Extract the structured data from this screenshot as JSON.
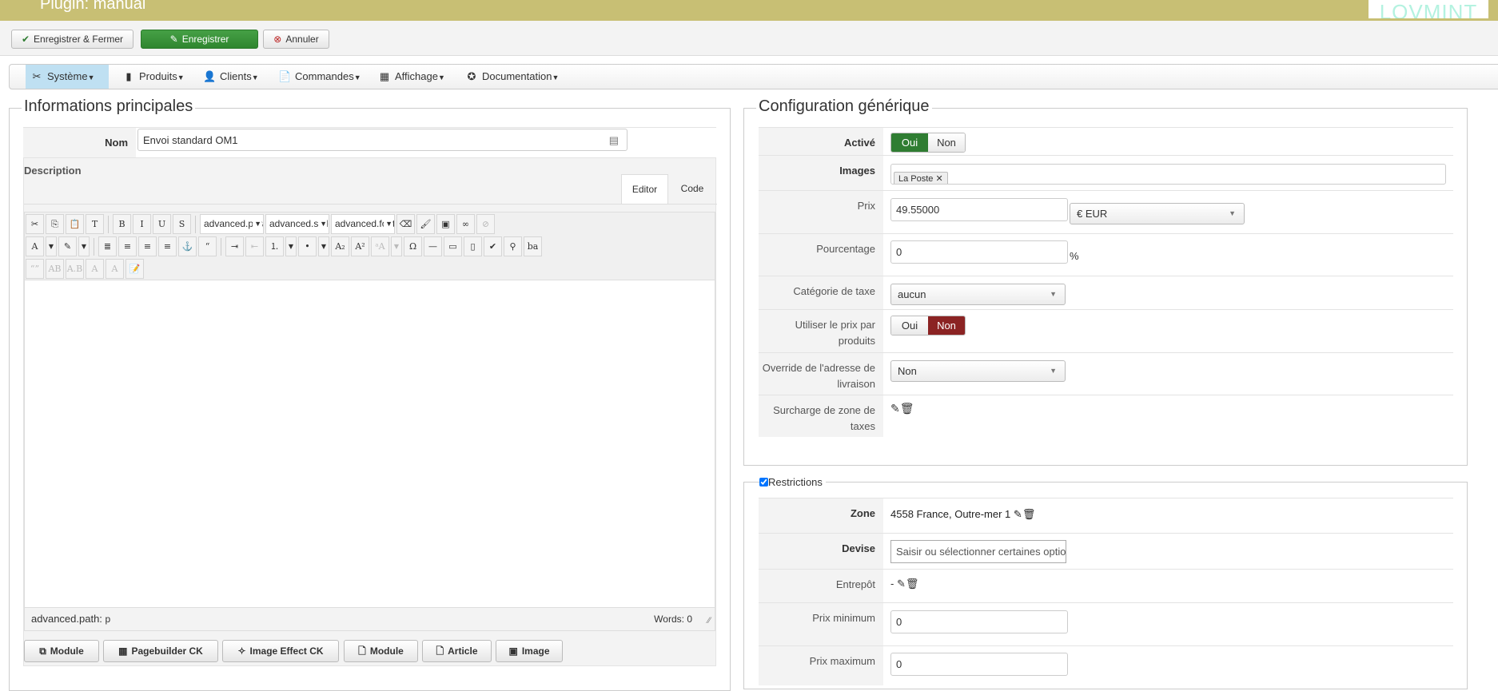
{
  "header": {
    "title": "Plugin: manual",
    "logo": "LOVMINT"
  },
  "toolbar": {
    "save_close": "Enregistrer & Fermer",
    "save": "Enregistrer",
    "cancel": "Annuler"
  },
  "menu": [
    {
      "label": "Système",
      "icon": "wrench-icon",
      "glyph": "✂"
    },
    {
      "label": "Produits",
      "icon": "box-icon",
      "glyph": "▮"
    },
    {
      "label": "Clients",
      "icon": "user-icon",
      "glyph": "👤"
    },
    {
      "label": "Commandes",
      "icon": "order-icon",
      "glyph": "📄"
    },
    {
      "label": "Affichage",
      "icon": "display-icon",
      "glyph": "▦"
    },
    {
      "label": "Documentation",
      "icon": "help-icon",
      "glyph": "✪"
    }
  ],
  "left": {
    "legend": "Informations principales",
    "nom_label": "Nom",
    "nom_value": "Envoi standard OM1",
    "description_label": "Description",
    "tabs": [
      "Editor",
      "Code"
    ],
    "editor_rows": [
      [
        {
          "n": "cut-icon",
          "g": "✂"
        },
        {
          "n": "copy-icon",
          "g": "⎘"
        },
        {
          "n": "paste-icon",
          "g": "📋"
        },
        {
          "n": "paste-text-icon",
          "g": "T"
        },
        {
          "sep": 1
        },
        {
          "n": "bold-icon",
          "g": "B"
        },
        {
          "n": "italic-icon",
          "g": "I"
        },
        {
          "n": "underline-icon",
          "g": "U"
        },
        {
          "n": "strikethrough-icon",
          "g": "S"
        },
        {
          "sep": 1
        },
        {
          "dd": "advanced.paragraph"
        },
        {
          "dd": "advanced.style"
        },
        {
          "dd": "advanced.font"
        },
        {
          "n": "eraser-icon",
          "g": "⌫"
        },
        {
          "n": "cleanup-icon",
          "g": "🖌"
        },
        {
          "n": "image-icon",
          "g": "▣"
        },
        {
          "n": "link-icon",
          "g": "∞"
        },
        {
          "n": "unlink-icon",
          "g": "⊘",
          "d": 1
        }
      ],
      [
        {
          "n": "text-color-icon",
          "g": "A"
        },
        {
          "n": "dropdown-icon",
          "g": "▼"
        },
        {
          "n": "highlight-icon",
          "g": "✎"
        },
        {
          "n": "dropdown-icon",
          "g": "▼"
        },
        {
          "sep": 1
        },
        {
          "n": "justify-icon",
          "g": "≣"
        },
        {
          "n": "align-center-icon",
          "g": "≡"
        },
        {
          "n": "align-left-icon",
          "g": "≡"
        },
        {
          "n": "align-right-icon",
          "g": "≡"
        },
        {
          "n": "anchor-icon",
          "g": "⚓"
        },
        {
          "n": "blockquote-icon",
          "g": "“"
        },
        {
          "sep": 1
        },
        {
          "n": "indent-icon",
          "g": "⇥"
        },
        {
          "n": "outdent-icon",
          "g": "⇤",
          "d": 1
        },
        {
          "n": "ordered-list-icon",
          "g": "⒈"
        },
        {
          "n": "dropdown-icon",
          "g": "▼"
        },
        {
          "n": "unordered-list-icon",
          "g": "•"
        },
        {
          "n": "dropdown-icon",
          "g": "▼"
        },
        {
          "n": "subscript-icon",
          "g": "A₂"
        },
        {
          "n": "superscript-icon",
          "g": "A²"
        },
        {
          "n": "font-size-icon",
          "g": "ᵃA",
          "d": 1
        },
        {
          "n": "dropdown-icon",
          "g": "▼",
          "d": 1
        },
        {
          "n": "special-char-icon",
          "g": "Ω"
        },
        {
          "n": "horizontal-rule-icon",
          "g": "—"
        },
        {
          "n": "table-icon",
          "g": "▭"
        },
        {
          "n": "template-icon",
          "g": "▯"
        },
        {
          "n": "spellcheck-icon",
          "g": "✔"
        },
        {
          "n": "search-icon",
          "g": "⚲"
        },
        {
          "n": "replace-icon",
          "g": "ba"
        }
      ],
      [
        {
          "n": "cite-icon",
          "g": "“”",
          "d": 1
        },
        {
          "n": "abbr-icon",
          "g": "AB",
          "d": 1
        },
        {
          "n": "acronym-icon",
          "g": "A.B",
          "d": 1
        },
        {
          "n": "del-icon",
          "g": "A",
          "d": 1
        },
        {
          "n": "ins-icon",
          "g": "A",
          "d": 1
        },
        {
          "n": "attributes-icon",
          "g": "📝"
        }
      ]
    ],
    "path_label": "advanced.path:",
    "path_value": "p",
    "words_label": "Words:",
    "words_value": "0",
    "buttons": [
      {
        "label": "Module",
        "icon": "module-icon",
        "glyph": "⧉"
      },
      {
        "label": "Pagebuilder CK",
        "icon": "grid-icon",
        "glyph": "▦"
      },
      {
        "label": "Image Effect CK",
        "icon": "magic-wand-icon",
        "glyph": "✧"
      },
      {
        "label": "Module",
        "icon": "module-insert-icon",
        "glyph": "🗋"
      },
      {
        "label": "Article",
        "icon": "article-icon",
        "glyph": "🗋"
      },
      {
        "label": "Image",
        "icon": "image-icon",
        "glyph": "▣"
      }
    ]
  },
  "config": {
    "legend": "Configuration générique",
    "active_label": "Activé",
    "yes": "Oui",
    "no": "Non",
    "images_label": "Images",
    "images_tag": "La Poste",
    "price_label": "Prix",
    "price_value": "49.55000",
    "currency": "€ EUR",
    "percent_label": "Pourcentage",
    "percent_value": "0",
    "percent_unit": "%",
    "tax_label": "Catégorie de taxe",
    "tax_value": "aucun",
    "use_product_price_label": "Utiliser le prix par produits",
    "override_label": "Override de l'adresse de livraison",
    "override_value": "Non",
    "tax_zone_label": "Surcharge de zone de taxes"
  },
  "restrictions": {
    "legend": "Restrictions",
    "checked": true,
    "zone_label": "Zone",
    "zone_value": "4558 France, Outre-mer 1",
    "currency_label": "Devise",
    "currency_placeholder": "Saisir ou sélectionner certaines options",
    "warehouse_label": "Entrepôt",
    "warehouse_value": "-",
    "min_label": "Prix minimum",
    "min_value": "0",
    "max_label": "Prix maximum",
    "max_value": "0"
  },
  "colors": {
    "header": "#c8bf74",
    "green": "#2f7d32",
    "red": "#8b2323",
    "menu_active": "#bfe0f2"
  }
}
